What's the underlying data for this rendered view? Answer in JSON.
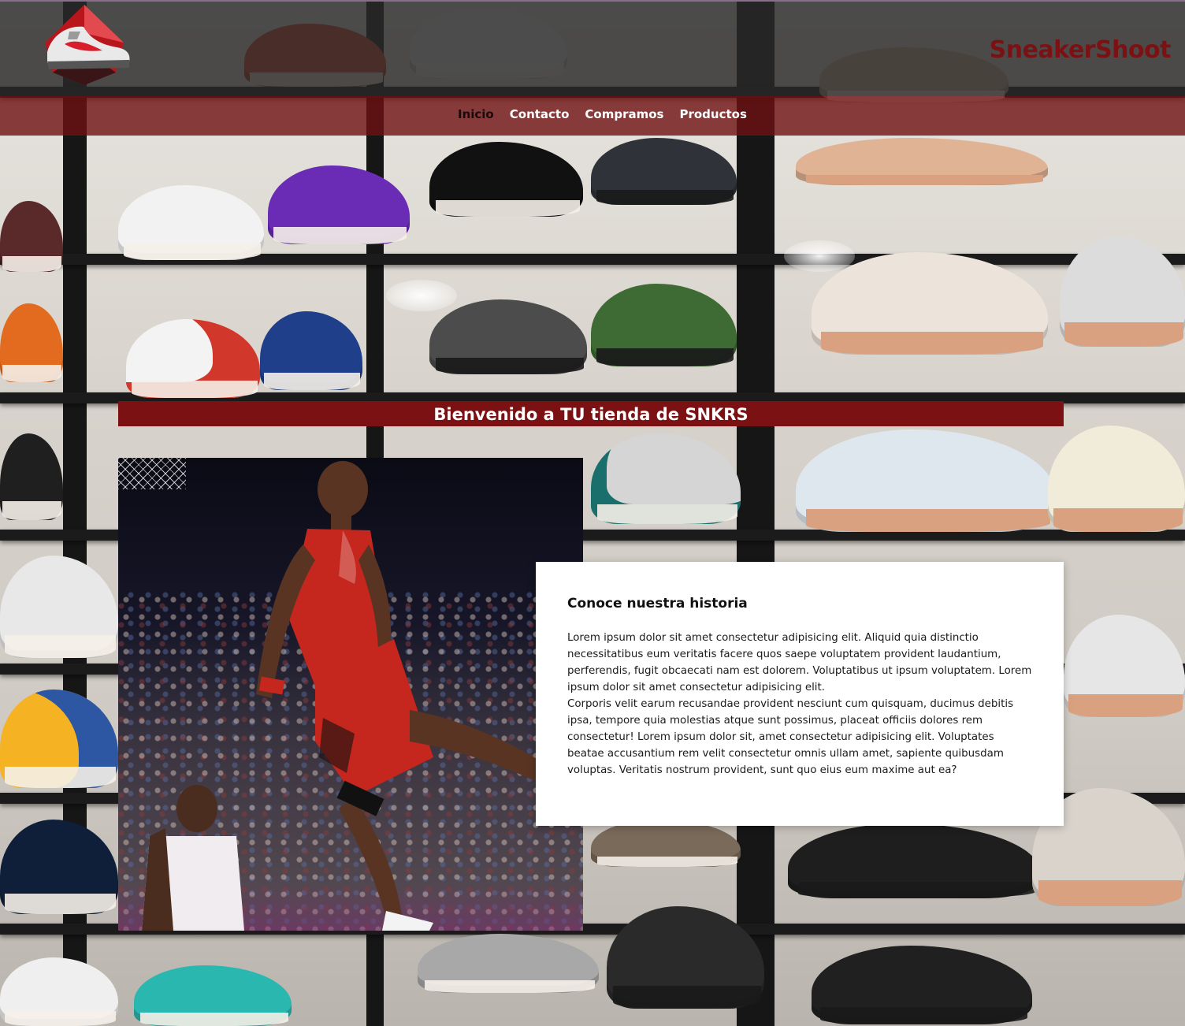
{
  "header": {
    "brand": "SneakerShoot",
    "logo_icon": "sneaker-logo-icon",
    "colors": {
      "brand_red": "#7b1113",
      "header_dark": "#282828",
      "nav_red": "#6e1012"
    }
  },
  "nav": {
    "items": [
      {
        "label": "Inicio",
        "active": true
      },
      {
        "label": "Contacto",
        "active": false
      },
      {
        "label": "Compramos",
        "active": false
      },
      {
        "label": "Productos",
        "active": false
      }
    ]
  },
  "hero": {
    "welcome": "Bienvenido a TU tienda de SNKRS"
  },
  "story": {
    "title": "Conoce nuestra historia",
    "paragraphs": [
      "Lorem ipsum dolor sit amet consectetur adipisicing elit. Aliquid quia distinctio necessitatibus eum veritatis facere quos saepe voluptatem provident laudantium, perferendis, fugit obcaecati nam est dolorem. Voluptatibus ut ipsum voluptatem. Lorem ipsum dolor sit amet consectetur adipisicing elit.",
      "Corporis velit earum recusandae provident nesciunt cum quisquam, ducimus debitis ipsa, tempore quia molestias atque sunt possimus, placeat officiis dolores rem consectetur! Lorem ipsum dolor sit, amet consectetur adipisicing elit. Voluptates beatae accusantium rem velit consectetur omnis ullam amet, sapiente quibusdam voluptas. Veritatis nostrum provident, sunt quo eius eum maxime aut ea?"
    ]
  }
}
